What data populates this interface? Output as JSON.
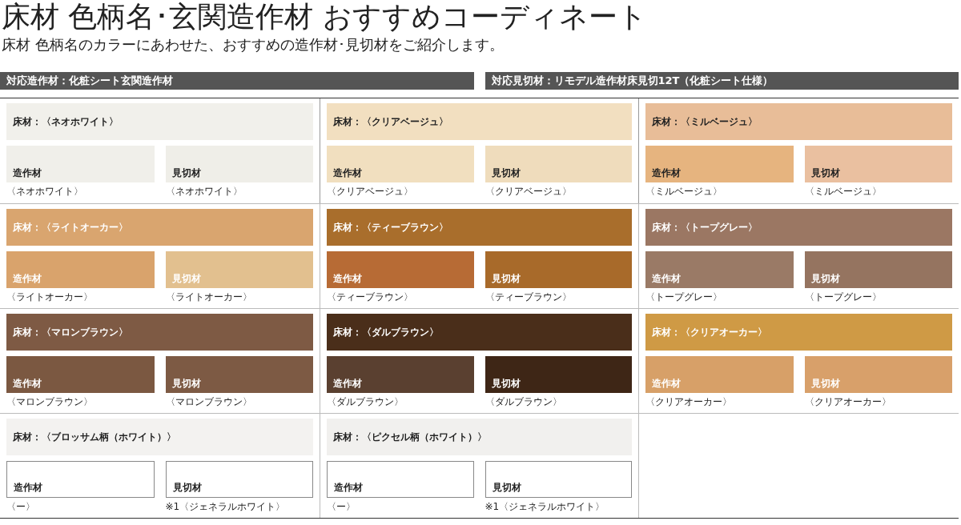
{
  "title": "床材 色柄名･玄関造作材 おすすめコーディネート",
  "subtitle": "床材 色柄名のカラーにあわせた、おすすめの造作材･見切材をご紹介します。",
  "headers": [
    "対応造作材：化粧シート玄関造作材",
    "対応見切材：リモデル造作材床見切12T（化粧シート仕様）"
  ],
  "cells": [
    {
      "floor": {
        "kind": "light",
        "label": "床材：〈ネオホワイト〉",
        "color": "#f1f0eb"
      },
      "trims": [
        {
          "kind": "light",
          "label": "造作材",
          "caption": "〈ネオホワイト〉",
          "color": "#f0efea"
        },
        {
          "kind": "light",
          "label": "見切材",
          "caption": "〈ネオホワイト〉",
          "color": "#efeee8"
        }
      ]
    },
    {
      "floor": {
        "kind": "light",
        "label": "床材：〈クリアベージュ〉",
        "color": "#f2dfc0"
      },
      "trims": [
        {
          "kind": "light",
          "label": "造作材",
          "caption": "〈クリアベージュ〉",
          "color": "#f1dfbf"
        },
        {
          "kind": "light",
          "label": "見切材",
          "caption": "〈クリアベージュ〉",
          "color": "#efdcbc"
        }
      ]
    },
    {
      "floor": {
        "kind": "light",
        "label": "床材：〈ミルベージュ〉",
        "color": "#e8bd98"
      },
      "trims": [
        {
          "kind": "light",
          "label": "造作材",
          "caption": "〈ミルベージュ〉",
          "color": "#e6b47f"
        },
        {
          "kind": "light",
          "label": "見切材",
          "caption": "〈ミルベージュ〉",
          "color": "#eac0a0"
        }
      ]
    },
    {
      "floor": {
        "kind": "dark",
        "label": "床材：〈ライトオーカー〉",
        "color": "#d9a56f"
      },
      "trims": [
        {
          "kind": "dark",
          "label": "造作材",
          "caption": "〈ライトオーカー〉",
          "color": "#d9a36c"
        },
        {
          "kind": "dark",
          "label": "見切材",
          "caption": "〈ライトオーカー〉",
          "color": "#e2c08f"
        }
      ]
    },
    {
      "floor": {
        "kind": "dark",
        "label": "床材：〈ティーブラウン〉",
        "color": "#a96e2c"
      },
      "trims": [
        {
          "kind": "dark",
          "label": "造作材",
          "caption": "〈ティーブラウン〉",
          "color": "#b76b35"
        },
        {
          "kind": "dark",
          "label": "見切材",
          "caption": "〈ティーブラウン〉",
          "color": "#a86a2a"
        }
      ]
    },
    {
      "floor": {
        "kind": "dark",
        "label": "床材：〈トープグレー〉",
        "color": "#9b7763"
      },
      "trims": [
        {
          "kind": "dark",
          "label": "造作材",
          "caption": "〈トープグレー〉",
          "color": "#9a7a66"
        },
        {
          "kind": "dark",
          "label": "見切材",
          "caption": "〈トープグレー〉",
          "color": "#957460"
        }
      ]
    },
    {
      "floor": {
        "kind": "dark",
        "label": "床材：〈マロンブラウン〉",
        "color": "#7e5a44"
      },
      "trims": [
        {
          "kind": "dark",
          "label": "造作材",
          "caption": "〈マロンブラウン〉",
          "color": "#7b5841"
        },
        {
          "kind": "dark",
          "label": "見切材",
          "caption": "〈マロンブラウン〉",
          "color": "#7d5a44"
        }
      ]
    },
    {
      "floor": {
        "kind": "dark",
        "label": "床材：〈ダルブラウン〉",
        "color": "#4a2e1a"
      },
      "trims": [
        {
          "kind": "dark",
          "label": "造作材",
          "caption": "〈ダルブラウン〉",
          "color": "#5a4030"
        },
        {
          "kind": "dark",
          "label": "見切材",
          "caption": "〈ダルブラウン〉",
          "color": "#3e2616"
        }
      ]
    },
    {
      "floor": {
        "kind": "dark",
        "label": "床材：〈クリアオーカー〉",
        "color": "#cf9a45"
      },
      "trims": [
        {
          "kind": "dark",
          "label": "造作材",
          "caption": "〈クリアオーカー〉",
          "color": "#d7a068"
        },
        {
          "kind": "dark",
          "label": "見切材",
          "caption": "〈クリアオーカー〉",
          "color": "#d8a06a"
        }
      ]
    },
    {
      "floor": {
        "kind": "light",
        "label": "床材：〈ブロッサム柄（ホワイト）〉",
        "color": "#f3f2f0"
      },
      "trims": [
        {
          "kind": "blank",
          "label": "造作材",
          "caption": "〈ー〉"
        },
        {
          "kind": "blank",
          "label": "見切材",
          "caption": "※1〈ジェネラルホワイト〉"
        }
      ]
    },
    {
      "floor": {
        "kind": "light",
        "label": "床材：〈ピクセル柄（ホワイト）〉",
        "color": "#f1f0ee"
      },
      "trims": [
        {
          "kind": "blank",
          "label": "造作材",
          "caption": "〈ー〉"
        },
        {
          "kind": "blank",
          "label": "見切材",
          "caption": "※1〈ジェネラルホワイト〉"
        }
      ]
    }
  ]
}
